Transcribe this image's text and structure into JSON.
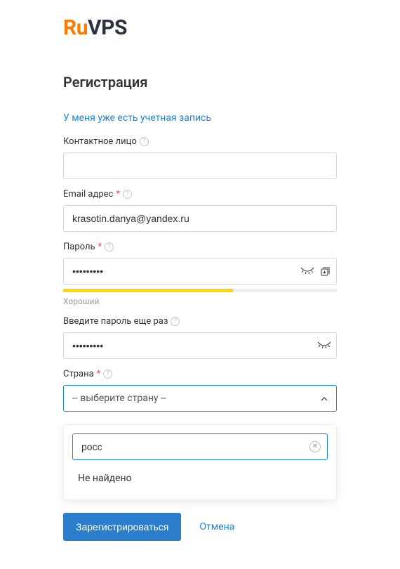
{
  "logo": {
    "ru": "Ru",
    "vps": "VPS"
  },
  "title": "Регистрация",
  "existing_link": "У меня уже есть учетная запись",
  "fields": {
    "contact": {
      "label": "Контактное лицо",
      "value": ""
    },
    "email": {
      "label": "Email адрес",
      "value": "krasotin.danya@yandex.ru"
    },
    "password": {
      "label": "Пароль",
      "value": "•••••••••",
      "strength_label": "Хороший",
      "strength_pct": 62
    },
    "password_confirm": {
      "label": "Введите пароль еще раз",
      "value": "•••••••••"
    },
    "country": {
      "label": "Страна",
      "placeholder": "-- выберите страну --"
    }
  },
  "dropdown": {
    "search_value": "росс",
    "no_results": "Не найдено"
  },
  "actions": {
    "submit": "Зарегистрироваться",
    "cancel": "Отмена"
  }
}
